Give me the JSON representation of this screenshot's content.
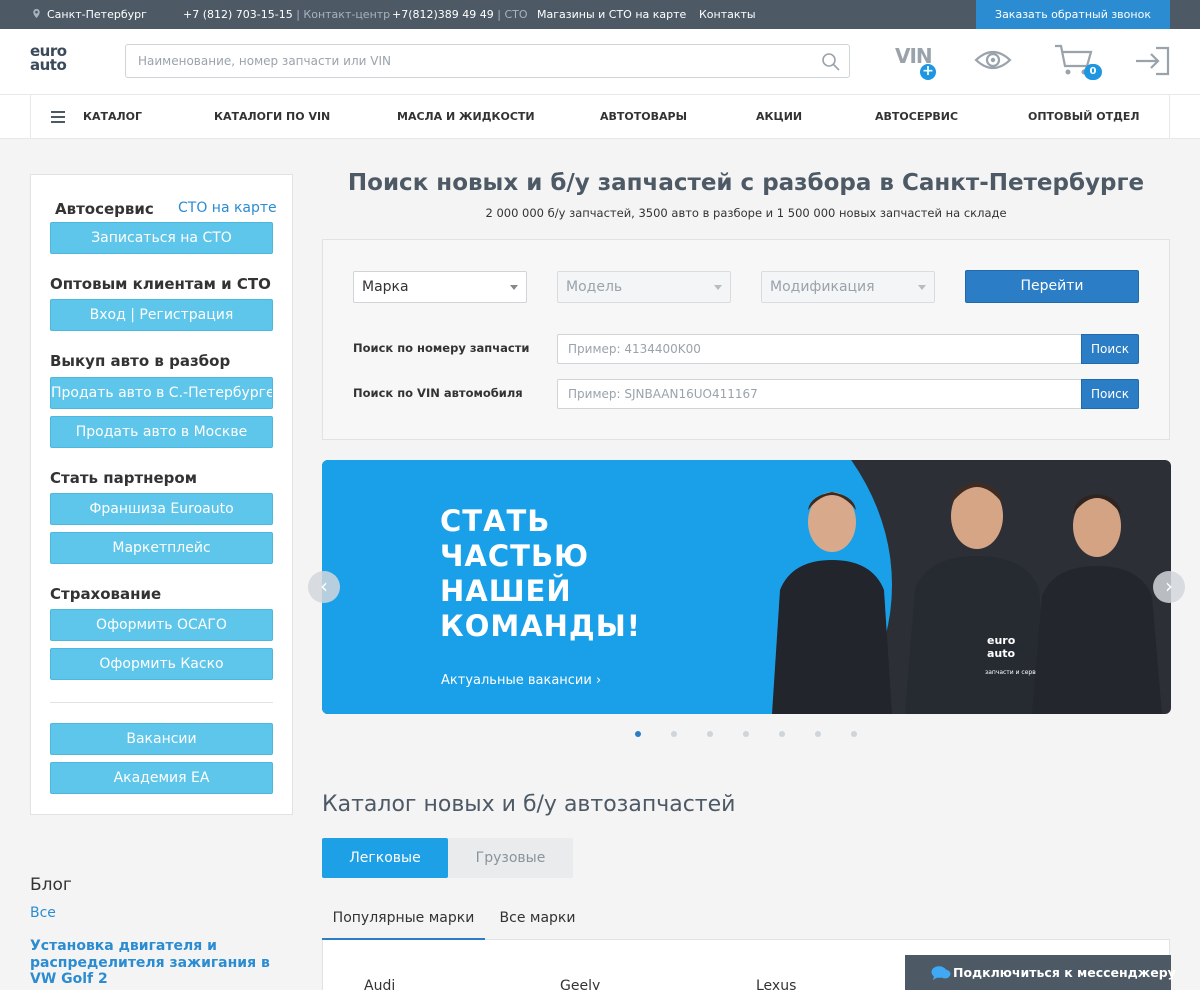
{
  "topbar": {
    "city": "Санкт-Петербург",
    "phone1": "+7 (812) 703-15-15",
    "phone1_note": "| Контакт-центр",
    "phone2": "+7(812)389 49 49",
    "phone2_note": "| СТО",
    "stores_link": "Магазины и СТО на карте",
    "contacts_link": "Контакты",
    "callback_button": "Заказать обратный звонок"
  },
  "header": {
    "logo_line1": "euro",
    "logo_line2": "auto",
    "search_placeholder": "Наименование, номер запчасти или VIN",
    "vin_label": "VIN",
    "vin_plus": "+",
    "cart_count": "0"
  },
  "nav": {
    "items": [
      "КАТАЛОГ",
      "КАТАЛОГИ ПО VIN",
      "МАСЛА И ЖИДКОСТИ",
      "АВТОТОВАРЫ",
      "АКЦИИ",
      "АВТОСЕРВИС",
      "ОПТОВЫЙ ОТДЕЛ"
    ]
  },
  "sidebar": {
    "autoservice_title": "Автосервис",
    "sto_map_link": "СТО на карте",
    "signup_sto": "Записаться на СТО",
    "wholesale_title": "Оптовым клиентам и СТО",
    "login_register": "Вход | Регистрация",
    "buyout_title": "Выкуп авто в разбор",
    "sell_spb": "Продать авто в С.-Петербурге",
    "sell_msk": "Продать авто в Москве",
    "partner_title": "Стать партнером",
    "franchise": "Франшиза Euroauto",
    "marketplace": "Маркетплейс",
    "insurance_title": "Страхование",
    "osago": "Оформить ОСАГО",
    "kasko": "Оформить Каско",
    "vacancies": "Вакансии",
    "academy": "Академия ЕА"
  },
  "blog": {
    "title": "Блог",
    "all_link": "Все",
    "post_title": "Установка двигателя и распределителя зажигания в VW Golf 2"
  },
  "main": {
    "title": "Поиск новых и б/у запчастей с разбора в Санкт-Петербурге",
    "subtitle": "2 000 000 б/у запчастей, 3500 авто в разборе и 1 500 000 новых запчастей на складе",
    "select_make": "Марка",
    "select_model": "Модель",
    "select_modification": "Модификация",
    "go_button": "Перейти",
    "part_search_label": "Поиск по номеру запчасти",
    "part_search_placeholder": "Пример: 4134400K00",
    "vin_search_label": "Поиск по VIN автомобиля",
    "vin_search_placeholder": "Пример: SJNBAAN16UO411167",
    "search_button": "Поиск"
  },
  "banner": {
    "headline": "СТАТЬ\nЧАСТЬЮ\nНАШЕЙ\nКОМАНДЫ!",
    "link": "Актуальные вакансии",
    "uniform_logo_line1": "euro",
    "uniform_logo_line2": "auto",
    "uniform_caption": "запчасти и сервис",
    "slides_count": 7,
    "active_slide": 1
  },
  "catalog": {
    "title": "Каталог новых и б/у автозапчастей",
    "segment_cars": "Легковые",
    "segment_trucks": "Грузовые",
    "tab_popular": "Популярные марки",
    "tab_all": "Все марки",
    "brands": [
      "Audi",
      "Geely",
      "Lexus"
    ]
  },
  "messenger": {
    "label": "Подключиться к мессенджеру"
  },
  "colors": {
    "topbar_bg": "#4d5a66",
    "accent_blue": "#2b7dc6",
    "light_blue_button": "#5ec6ea",
    "banner_blue": "#1aa0e8"
  }
}
